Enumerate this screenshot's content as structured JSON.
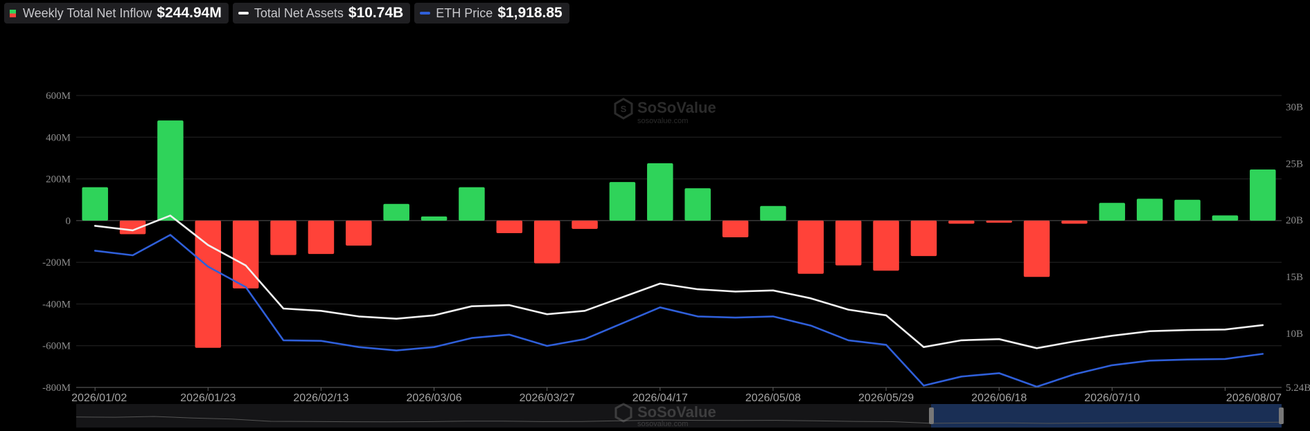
{
  "legend": {
    "inflow": {
      "label": "Weekly Total Net Inflow",
      "value": "$244.94M",
      "up_color": "#2fd35a",
      "down_color": "#ff4239"
    },
    "assets": {
      "label": "Total Net Assets",
      "value": "$10.74B",
      "color": "#f2f2f2"
    },
    "eth": {
      "label": "ETH Price",
      "value": "$1,918.85",
      "color": "#2f5fd9"
    }
  },
  "watermark": {
    "name": "SoSoValue",
    "domain": "sosovalue.com"
  },
  "chart_data": {
    "type": "bar",
    "colors": {
      "positive": "#2fd35a",
      "negative": "#ff4239",
      "assets_line": "#f2f2f2",
      "eth_line": "#2f5fd9"
    },
    "x": [
      "2026/01/02",
      "2026/01/09",
      "2026/01/16",
      "2026/01/23",
      "2026/01/30",
      "2026/02/06",
      "2026/02/13",
      "2026/02/20",
      "2026/02/27",
      "2026/03/06",
      "2026/03/13",
      "2026/03/20",
      "2026/03/27",
      "2026/04/03",
      "2026/04/10",
      "2026/04/17",
      "2026/04/24",
      "2026/05/01",
      "2026/05/08",
      "2026/05/15",
      "2026/05/22",
      "2026/05/29",
      "2026/06/05",
      "2026/06/12",
      "2026/06/18",
      "2026/06/26",
      "2026/07/03",
      "2026/07/10",
      "2026/07/17",
      "2026/07/24",
      "2026/07/31",
      "2026/08/07"
    ],
    "x_tick_labels": [
      "2026/01/02",
      "2026/01/23",
      "2026/02/13",
      "2026/03/06",
      "2026/03/27",
      "2026/04/17",
      "2026/05/08",
      "2026/05/29",
      "2026/06/18",
      "2026/07/10",
      "2026/08/07"
    ],
    "x_tick_index": [
      0,
      3,
      6,
      9,
      12,
      15,
      18,
      21,
      24,
      27,
      30
    ],
    "y_left": {
      "range": [
        -800,
        600
      ],
      "ticks": [
        -800,
        -600,
        -400,
        -200,
        0,
        200,
        400,
        600
      ],
      "tick_labels": [
        "-800M",
        "-600M",
        "-400M",
        "-200M",
        "0",
        "200M",
        "400M",
        "600M"
      ]
    },
    "y_right": {
      "range": [
        5.24,
        31
      ],
      "ticks": [
        5.24,
        10,
        15,
        20,
        25,
        30
      ],
      "tick_labels": [
        "5.24B",
        "10B",
        "15B",
        "20B",
        "25B",
        "30B"
      ]
    },
    "series": [
      {
        "name": "Weekly Total Net Inflow",
        "kind": "bar",
        "axis": "left",
        "values": [
          160,
          -65,
          480,
          -610,
          -325,
          -165,
          -160,
          -120,
          80,
          20,
          160,
          -60,
          -205,
          -40,
          185,
          275,
          155,
          -80,
          70,
          -255,
          -215,
          -240,
          -170,
          -15,
          -10,
          -270,
          -15,
          85,
          105,
          100,
          25,
          245
        ]
      },
      {
        "name": "Total Net Assets",
        "kind": "line",
        "axis": "right",
        "values": [
          19.5,
          19.1,
          20.4,
          17.8,
          16.0,
          12.2,
          12.0,
          11.5,
          11.3,
          11.6,
          12.4,
          12.5,
          11.7,
          12.0,
          13.2,
          14.4,
          13.9,
          13.7,
          13.8,
          13.1,
          12.1,
          11.6,
          8.8,
          9.4,
          9.5,
          8.7,
          9.3,
          9.8,
          10.2,
          10.3,
          10.35,
          10.74
        ]
      },
      {
        "name": "ETH Price",
        "kind": "line",
        "axis": "right",
        "values": [
          17.3,
          16.9,
          18.7,
          15.9,
          14.1,
          9.4,
          9.35,
          8.8,
          8.5,
          8.8,
          9.6,
          9.9,
          8.9,
          9.5,
          10.9,
          12.3,
          11.5,
          11.4,
          11.5,
          10.7,
          9.4,
          9.0,
          5.4,
          6.2,
          6.5,
          5.3,
          6.4,
          7.2,
          7.6,
          7.7,
          7.75,
          8.2
        ]
      }
    ],
    "grid": true,
    "legend_position": "top-left"
  }
}
